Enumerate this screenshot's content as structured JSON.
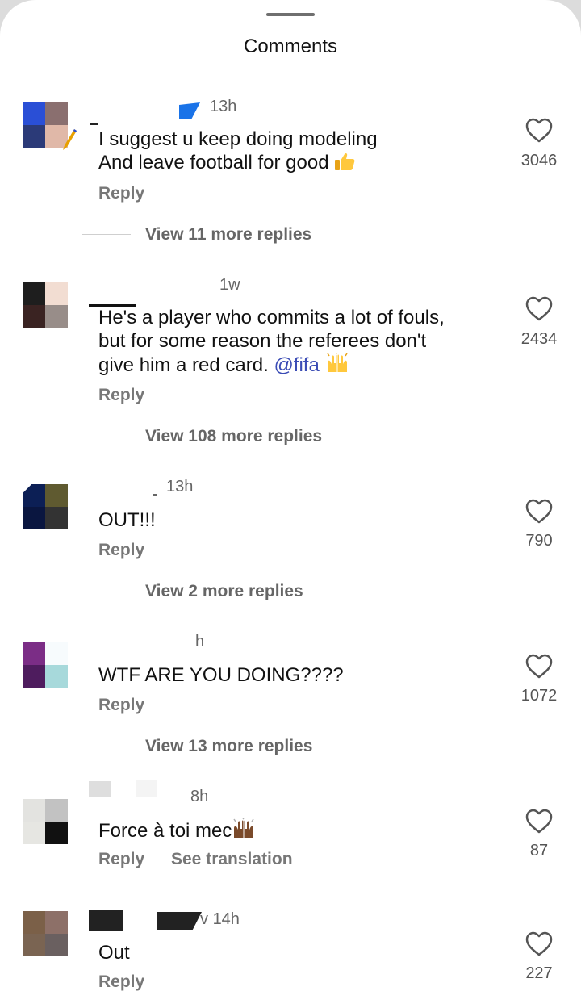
{
  "header": {
    "title": "Comments"
  },
  "comments": [
    {
      "time": "13h",
      "text": "I suggest u keep doing modeling\nAnd leave football for good",
      "emoji": "thumbs-up",
      "reply": "Reply",
      "likes": "3046",
      "view_replies": "View 11 more replies",
      "avatar": [
        "#2a4fd6",
        "#8a6f6f",
        "#2b3a78",
        "#e0b8a8"
      ]
    },
    {
      "time": "1w",
      "text": "He's a player who commits a lot of fouls,\nbut for some reason the referees don't\ngive him a red card.",
      "mention": "@fifa",
      "emoji": "raised-hands",
      "reply": "Reply",
      "likes": "2434",
      "view_replies": "View 108 more replies",
      "avatar": [
        "#1e1e1e",
        "#f2ddd2",
        "#3a2322",
        "#988d89"
      ]
    },
    {
      "time": "13h",
      "text": "OUT!!!",
      "reply": "Reply",
      "likes": "790",
      "view_replies": "View 2 more replies",
      "avatar": [
        "#0c1f55",
        "#5f5a30",
        "#0a1640",
        "#333333"
      ]
    },
    {
      "time": "h",
      "text": "WTF ARE YOU DOING????",
      "reply": "Reply",
      "likes": "1072",
      "view_replies": "View 13 more replies",
      "avatar": [
        "#7b2d86",
        "#f7fbfd",
        "#4e1c5e",
        "#a7d9db"
      ]
    },
    {
      "time": "8h",
      "text": "Force à toi mec",
      "emoji": "raised-hands-dark",
      "reply": "Reply",
      "translation": "See translation",
      "likes": "87",
      "avatar": [
        "#e3e3e0",
        "#c2c2c2",
        "#e6e6e2",
        "#111111"
      ]
    },
    {
      "time": "14h",
      "text": "Out",
      "reply": "Reply",
      "likes": "227",
      "avatar": [
        "#7b6048",
        "#8d7068",
        "#7a6452",
        "#6a6060"
      ]
    }
  ]
}
